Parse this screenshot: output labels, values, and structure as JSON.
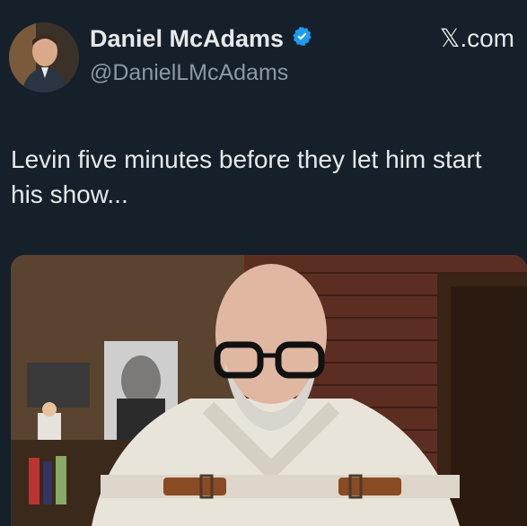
{
  "author": {
    "display_name": "Daniel McAdams",
    "handle": "@DanielLMcAdams",
    "verified_icon": "verified-badge-icon",
    "avatar_icon": "profile-avatar"
  },
  "source_label": "𝕏.com",
  "tweet": {
    "text": "Levin five minutes before they let him start his show..."
  },
  "media": {
    "description_icon": "man-in-straitjacket-photo"
  },
  "colors": {
    "background": "#15202b",
    "primary_text": "#e7e9ea",
    "secondary_text": "#8b98a5",
    "verified_blue": "#1d9bf0"
  }
}
